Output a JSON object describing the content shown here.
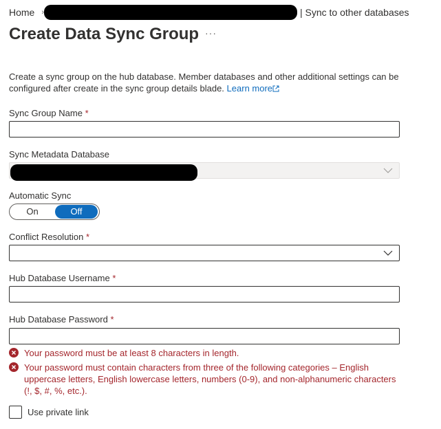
{
  "breadcrumb": {
    "home": "Home",
    "current": "| Sync to other databases"
  },
  "header": {
    "title": "Create Data Sync Group",
    "more_label": "..."
  },
  "description": {
    "text": "Create a sync group on the hub database. Member databases and other additional settings can be configured after create in the sync group details blade.",
    "link_text": "Learn more"
  },
  "form": {
    "sync_group_name": {
      "label": "Sync Group Name",
      "required_mark": "*",
      "value": ""
    },
    "sync_metadata_database": {
      "label": "Sync Metadata Database",
      "value": ""
    },
    "automatic_sync": {
      "label": "Automatic Sync",
      "on_label": "On",
      "off_label": "Off",
      "selected": "Off"
    },
    "conflict_resolution": {
      "label": "Conflict Resolution",
      "required_mark": "*",
      "value": ""
    },
    "hub_username": {
      "label": "Hub Database Username",
      "required_mark": "*",
      "value": ""
    },
    "hub_password": {
      "label": "Hub Database Password",
      "required_mark": "*",
      "value": ""
    },
    "errors": [
      "Your password must be at least 8 characters in length.",
      "Your password must contain characters from three of the following categories – English uppercase letters, English lowercase letters, numbers (0-9), and non-alphanumeric characters (!, $, #, %, etc.)."
    ],
    "private_link": {
      "label": "Use private link",
      "checked": false
    }
  },
  "colors": {
    "accent": "#0f6cbd",
    "error": "#a4262c",
    "text": "#323130"
  }
}
